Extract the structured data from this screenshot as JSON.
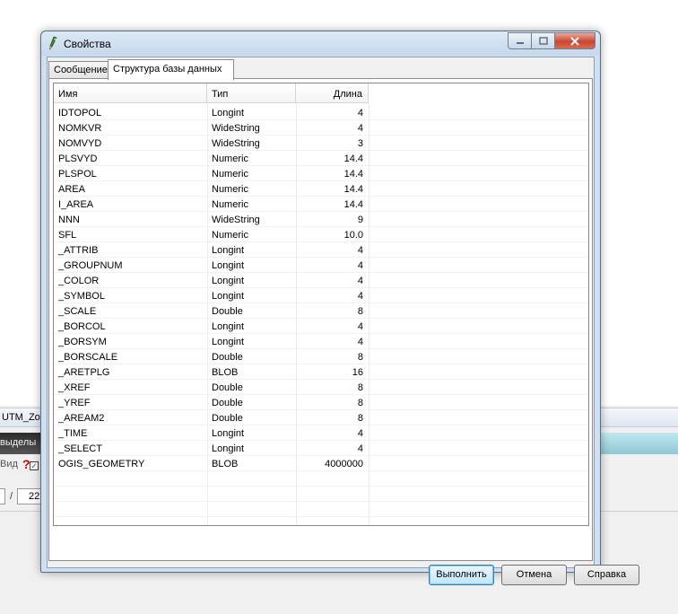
{
  "background_app": {
    "titlebar_text": "UTM_Zone",
    "toolbar_text": "выделы",
    "view_label": "Вид",
    "page_separator": "/",
    "page_total": "22"
  },
  "dialog": {
    "title": "Свойства",
    "icon": "properties-pen-icon",
    "tabs": [
      {
        "label": "Сообщение"
      },
      {
        "label": "Структура базы данных"
      }
    ],
    "active_tab": 1,
    "table": {
      "columns": [
        "Имя",
        "Тип",
        "Длина"
      ],
      "rows": [
        {
          "name": "IDTOPOL",
          "type": "Longint",
          "length": "4"
        },
        {
          "name": "NOMKVR",
          "type": "WideString",
          "length": "4"
        },
        {
          "name": "NOMVYD",
          "type": "WideString",
          "length": "3"
        },
        {
          "name": "PLSVYD",
          "type": "Numeric",
          "length": "14.4"
        },
        {
          "name": "PLSPOL",
          "type": "Numeric",
          "length": "14.4"
        },
        {
          "name": "AREA",
          "type": "Numeric",
          "length": "14.4"
        },
        {
          "name": "I_AREA",
          "type": "Numeric",
          "length": "14.4"
        },
        {
          "name": "NNN",
          "type": "WideString",
          "length": "9"
        },
        {
          "name": "SFL",
          "type": "Numeric",
          "length": "10.0"
        },
        {
          "name": "_ATTRIB",
          "type": "Longint",
          "length": "4"
        },
        {
          "name": "_GROUPNUM",
          "type": "Longint",
          "length": "4"
        },
        {
          "name": "_COLOR",
          "type": "Longint",
          "length": "4"
        },
        {
          "name": "_SYMBOL",
          "type": "Longint",
          "length": "4"
        },
        {
          "name": "_SCALE",
          "type": "Double",
          "length": "8"
        },
        {
          "name": "_BORCOL",
          "type": "Longint",
          "length": "4"
        },
        {
          "name": "_BORSYM",
          "type": "Longint",
          "length": "4"
        },
        {
          "name": "_BORSCALE",
          "type": "Double",
          "length": "8"
        },
        {
          "name": "_ARETPLG",
          "type": "BLOB",
          "length": "16"
        },
        {
          "name": "_XREF",
          "type": "Double",
          "length": "8"
        },
        {
          "name": "_YREF",
          "type": "Double",
          "length": "8"
        },
        {
          "name": "_AREAM2",
          "type": "Double",
          "length": "8"
        },
        {
          "name": "_TIME",
          "type": "Longint",
          "length": "4"
        },
        {
          "name": "_SELECT",
          "type": "Longint",
          "length": "4"
        },
        {
          "name": "OGIS_GEOMETRY",
          "type": "BLOB",
          "length": "4000000"
        }
      ]
    },
    "buttons": {
      "execute": "Выполнить",
      "cancel": "Отмена",
      "help": "Справка"
    }
  }
}
